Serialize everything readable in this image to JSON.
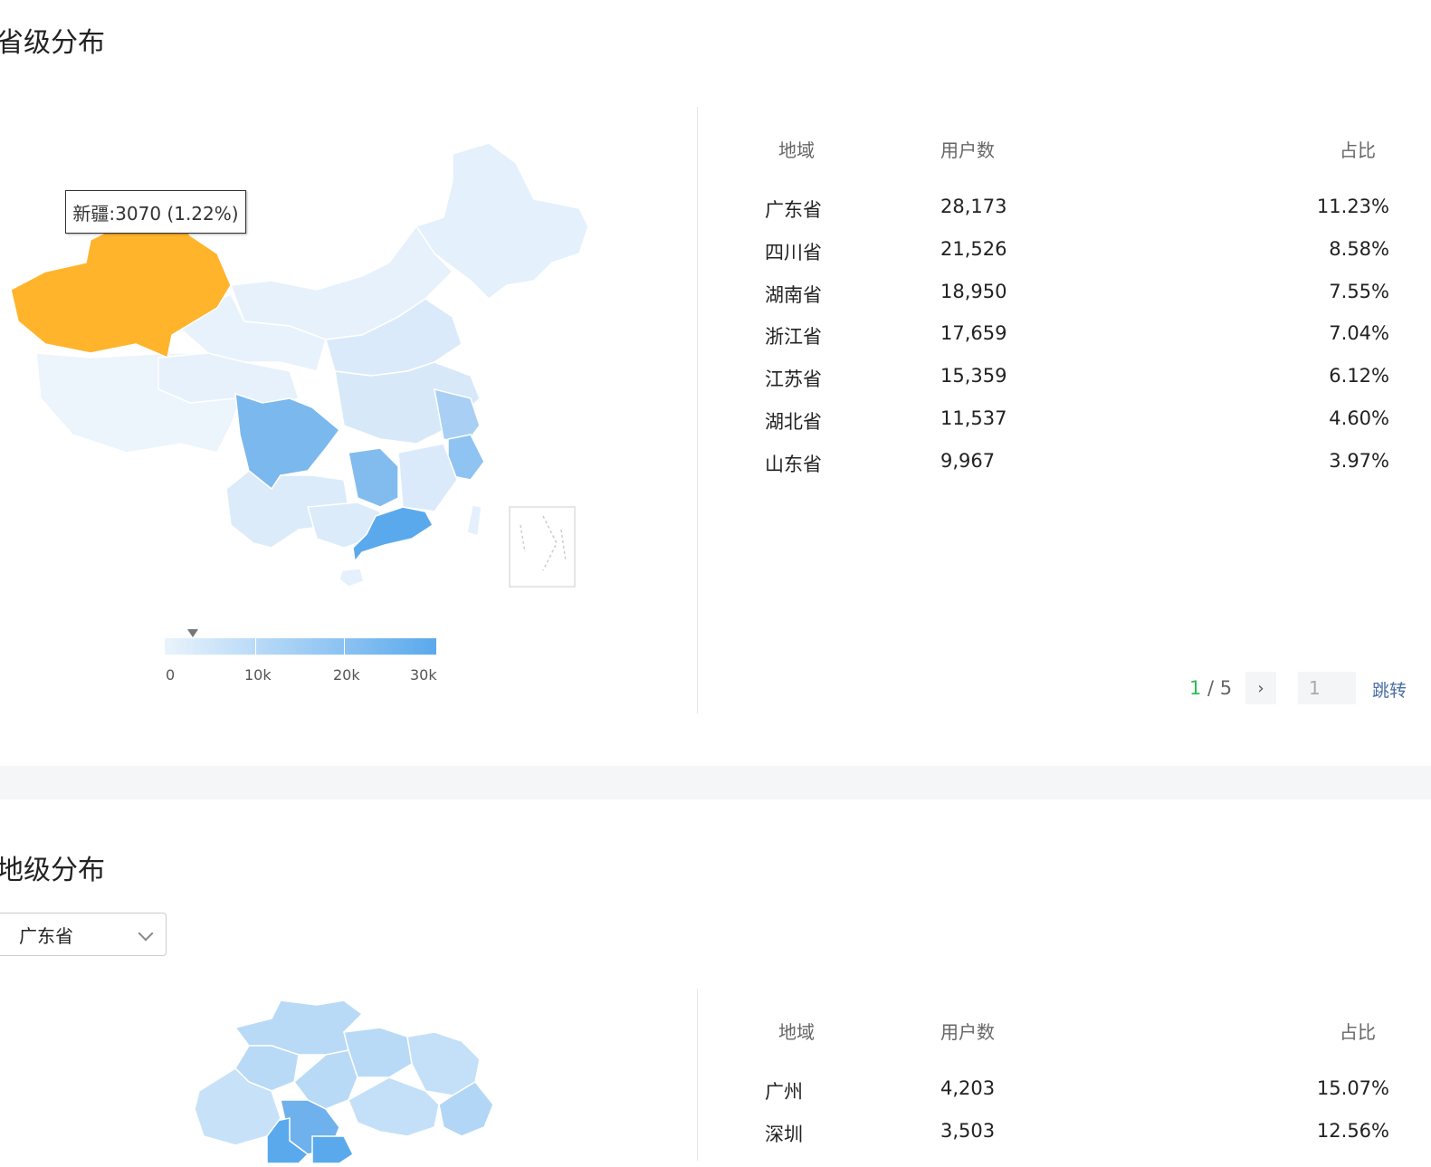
{
  "province_section": {
    "title": "省级分布",
    "tooltip": "新疆:3070 (1.22%)",
    "legend_ticks": [
      "0",
      "10k",
      "20k",
      "30k"
    ],
    "legend_marker_value": 3070,
    "legend_max": 30000,
    "columns": [
      "地域",
      "用户数",
      "占比"
    ],
    "rows": [
      {
        "region": "广东省",
        "users": "28,173",
        "share": "11.23%"
      },
      {
        "region": "四川省",
        "users": "21,526",
        "share": "8.58%"
      },
      {
        "region": "湖南省",
        "users": "18,950",
        "share": "7.55%"
      },
      {
        "region": "浙江省",
        "users": "17,659",
        "share": "7.04%"
      },
      {
        "region": "江苏省",
        "users": "15,359",
        "share": "6.12%"
      },
      {
        "region": "湖北省",
        "users": "11,537",
        "share": "4.60%"
      },
      {
        "region": "山东省",
        "users": "9,967",
        "share": "3.97%"
      }
    ],
    "pager": {
      "current": "1",
      "total_text": "/ 5",
      "input_value": "1",
      "jump_label": "跳转"
    }
  },
  "city_section": {
    "title": "地级分布",
    "selected_province": "广东省",
    "columns": [
      "地域",
      "用户数",
      "占比"
    ],
    "rows": [
      {
        "region": "广州",
        "users": "4,203",
        "share": "15.07%"
      },
      {
        "region": "深圳",
        "users": "3,503",
        "share": "12.56%"
      }
    ]
  },
  "colors": {
    "highlight": "#ffb42b",
    "map_light": "#e4f0fb",
    "map_mid": "#b6d8f6",
    "map_dark": "#5aa9ec",
    "pager_active": "#2cbd5a"
  }
}
